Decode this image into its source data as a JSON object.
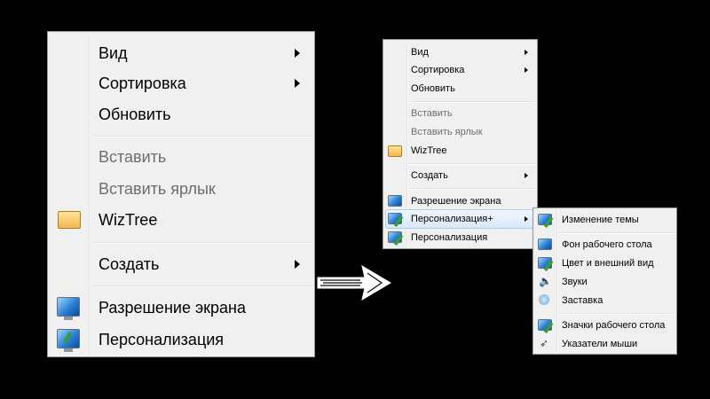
{
  "menu_large": {
    "items": [
      {
        "label": "Вид"
      },
      {
        "label": "Сортировка"
      },
      {
        "label": "Обновить"
      },
      {
        "label": "Вставить"
      },
      {
        "label": "Вставить ярлык"
      },
      {
        "label": "WizTree"
      },
      {
        "label": "Создать"
      },
      {
        "label": "Разрешение экрана"
      },
      {
        "label": "Персонализация"
      }
    ]
  },
  "menu_small": {
    "items": [
      {
        "label": "Вид"
      },
      {
        "label": "Сортировка"
      },
      {
        "label": "Обновить"
      },
      {
        "label": "Вставить"
      },
      {
        "label": "Вставить ярлык"
      },
      {
        "label": "WizTree"
      },
      {
        "label": "Создать"
      },
      {
        "label": "Разрешение экрана"
      },
      {
        "label": "Персонализация+"
      },
      {
        "label": "Персонализация"
      }
    ]
  },
  "submenu": {
    "items": [
      {
        "label": "Изменение темы"
      },
      {
        "label": "Фон рабочего стола"
      },
      {
        "label": "Цвет и внешний вид"
      },
      {
        "label": "Звуки"
      },
      {
        "label": "Заставка"
      },
      {
        "label": "Значки рабочего стола"
      },
      {
        "label": "Указатели мыши"
      }
    ]
  },
  "icons": {
    "wiztree": "folder-icon",
    "screen_resolution": "monitor-icon",
    "personalization": "monitor-brush-icon",
    "change_theme": "monitor-brush-icon",
    "desktop_background": "monitor-icon",
    "color_appearance": "monitor-brush-icon",
    "sounds": "speaker-icon",
    "screensaver": "screensaver-icon",
    "desktop_icons": "monitor-brush-icon",
    "mouse_pointers": "cursor-icon"
  },
  "colors": {
    "background": "#000000",
    "menu_bg": "#f0f0f0",
    "disabled_text": "#6d6d6d",
    "highlight_border": "#aecdf1"
  }
}
